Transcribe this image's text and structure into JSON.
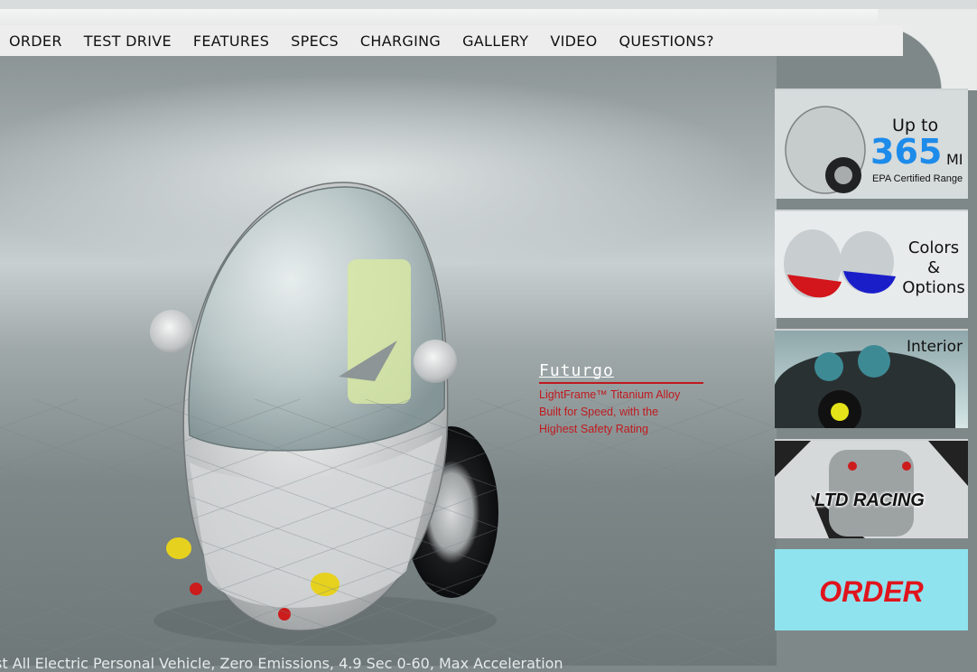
{
  "nav": {
    "items": [
      "ORDER",
      "TEST DRIVE",
      "FEATURES",
      "SPECS",
      "CHARGING",
      "GALLERY",
      "VIDEO",
      "QUESTIONS?"
    ]
  },
  "promo": {
    "logo": "Futurgo",
    "lines": [
      "LightFrame™ Titanium Alloy",
      "Built for Speed, with the",
      "Highest Safety Rating"
    ]
  },
  "sidebar": {
    "range": {
      "prefix": "Up to",
      "value": "365",
      "unit": "MI",
      "caption": "EPA Certified Range"
    },
    "colors": {
      "lines": [
        "Colors",
        "&",
        "Options"
      ]
    },
    "interior": {
      "label": "Interior"
    },
    "racing": {
      "label": "LTD RACING"
    },
    "order": {
      "label": "ORDER"
    }
  },
  "footer": {
    "text": "st All Electric Personal Vehicle, Zero Emissions, 4.9 Sec 0-60, Max Acceleration"
  },
  "colors": {
    "accent_red": "#e0141d",
    "range_blue": "#1d8bea",
    "order_bg": "#8fe3ef"
  }
}
